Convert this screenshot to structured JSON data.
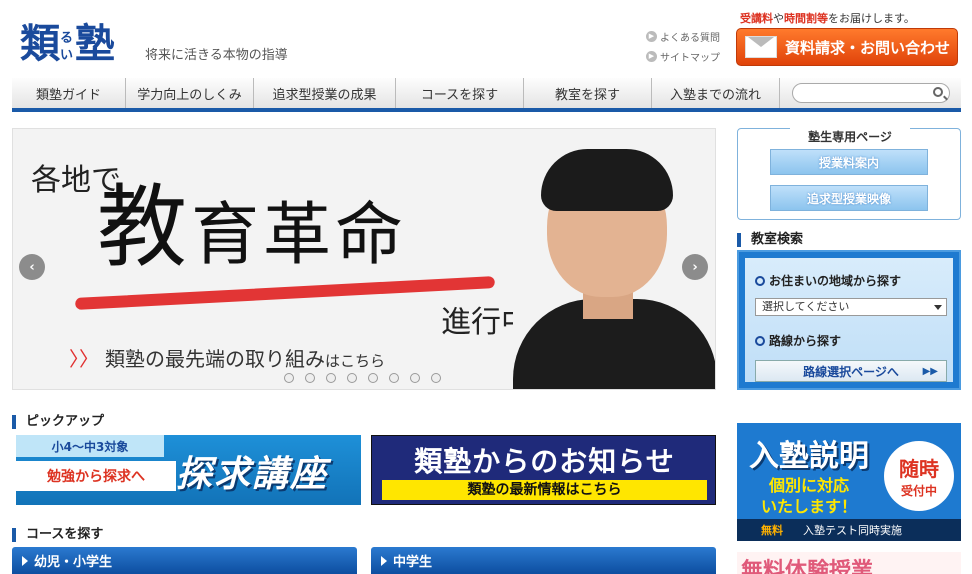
{
  "header": {
    "logo_main_1": "類",
    "logo_kana_1": "る",
    "logo_kana_2": "い",
    "logo_main_2": "塾",
    "tagline": "将来に活きる本物の指導",
    "util_links": [
      "よくある質問",
      "サイトマップ"
    ],
    "contact_note_red1": "受講料",
    "contact_note_mid": "や",
    "contact_note_red2": "時間割等",
    "contact_note_tail": "をお届けします。",
    "contact_button": "資料請求・お問い合わせ"
  },
  "nav": {
    "items": [
      "類塾ガイド",
      "学力向上のしくみ",
      "追求型授業の成果",
      "コースを探す",
      "教室を探す",
      "入塾までの流れ"
    ],
    "search_placeholder": ""
  },
  "hero": {
    "line1": "各地で",
    "big1": "教",
    "big2": "育革命",
    "sub": "進行中",
    "link_mark": "〉〉",
    "link_main": "類塾の最先端の取り組み",
    "link_tail": "はこちら",
    "prev": "‹",
    "next": "›",
    "slide_count": 8
  },
  "pickup": {
    "heading": "ピックアップ",
    "banner1": {
      "tag": "小4〜中3対象",
      "strip": "勉強から探求へ",
      "title": "探求講座"
    },
    "banner2": {
      "title": "類塾からのお知らせ",
      "sub": "類塾の最新情報はこちら"
    }
  },
  "course": {
    "heading": "コースを探す",
    "bars": [
      "幼児・小学生",
      "中学生"
    ]
  },
  "sidebar": {
    "member_title": "塾生専用ページ",
    "member_buttons": [
      "授業料案内",
      "追求型授業映像"
    ],
    "classroom_heading": "教室検索",
    "area_label": "お住まいの地域から探す",
    "area_select": "選択してください",
    "route_label": "路線から探す",
    "route_button": "路線選択ページへ",
    "setsumei": {
      "title": "入塾説明",
      "line1": "個別に対応",
      "line2": "いたします！",
      "circle1": "随時",
      "circle2": "受付中",
      "foot_free": "無料",
      "foot_text": "入塾テスト同時実施"
    },
    "bottom_cut": "無料体験授業"
  }
}
